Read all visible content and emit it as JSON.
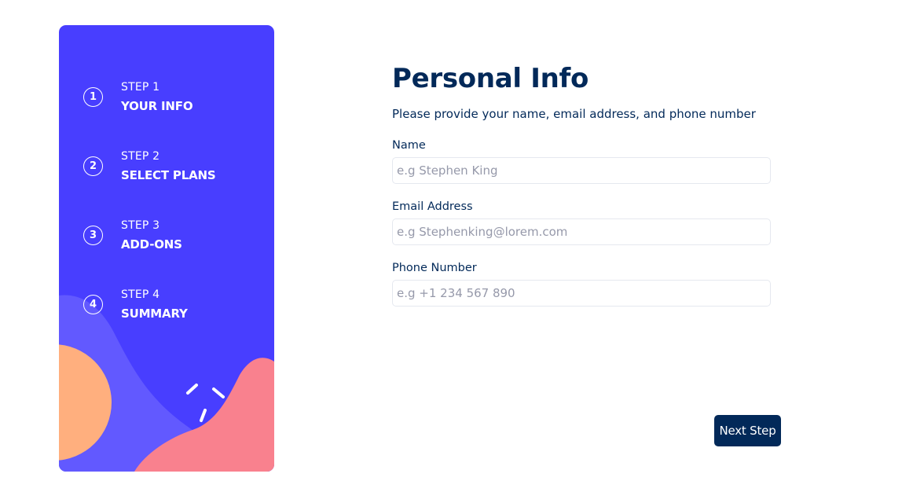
{
  "sidebar": {
    "steps": [
      {
        "number": "1",
        "kicker": "STEP 1",
        "title": "YOUR INFO"
      },
      {
        "number": "2",
        "kicker": "STEP 2",
        "title": "SELECT PLANS"
      },
      {
        "number": "3",
        "kicker": "STEP 3",
        "title": "ADD-ONS"
      },
      {
        "number": "4",
        "kicker": "STEP 4",
        "title": "SUMMARY"
      }
    ]
  },
  "main": {
    "title": "Personal Info",
    "subtitle": "Please provide your name, email address, and phone number",
    "fields": {
      "name": {
        "label": "Name",
        "placeholder": "e.g Stephen King",
        "value": ""
      },
      "email": {
        "label": "Email Address",
        "placeholder": "e.g Stephenking@lorem.com",
        "value": ""
      },
      "phone": {
        "label": "Phone Number",
        "placeholder": "e.g +1 234 567 890",
        "value": ""
      }
    },
    "next_button_label": "Next Step"
  },
  "colors": {
    "sidebar_bg": "#483eff",
    "sidebar_wave": "#6259ff",
    "sidebar_circle": "#ffaf7e",
    "sidebar_blob": "#f9818e",
    "primary_text": "#022959",
    "placeholder_text": "#9699aa",
    "border": "#e5e8ef",
    "button_bg": "#022959"
  }
}
